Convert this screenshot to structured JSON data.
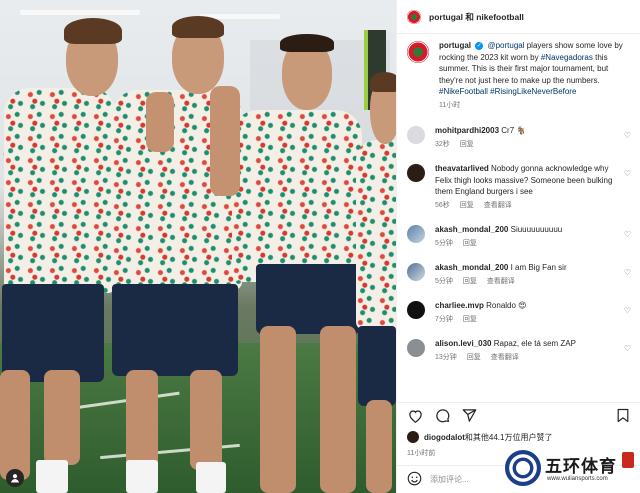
{
  "header": {
    "title": "portugal 和 nikefootball"
  },
  "caption": {
    "username": "portugal",
    "mention": "@portugal",
    "text_1": " players show some love by rocking the 2023 kit worn by ",
    "hashtag_1": "#Navegadoras",
    "text_2": " this summer. This is their first major tournament, but they're not just here to make up the numbers.",
    "hashtag_2": "#NikeFootball",
    "hashtag_3": "#RisingLikeNeverBefore",
    "time": "11小时"
  },
  "comments": [
    {
      "username": "mohitpardhi2003",
      "text": "Cr7 🐐",
      "time": "32秒",
      "reply": "回复",
      "translate": ""
    },
    {
      "username": "theavatarlived",
      "text": "Nobody gonna acknowledge why Felix thigh looks massive? Someone been bulking them England burgers i see",
      "time": "56秒",
      "reply": "回复",
      "translate": "查看翻译"
    },
    {
      "username": "akash_mondal_200",
      "text": "Siuuuuuuuuuu",
      "time": "5分钟",
      "reply": "回复",
      "translate": ""
    },
    {
      "username": "akash_mondal_200",
      "text": "I am Big Fan sir",
      "time": "5分钟",
      "reply": "回复",
      "translate": "查看翻译"
    },
    {
      "username": "charliee.mvp",
      "text": "Ronaldo 😍",
      "time": "7分钟",
      "reply": "回复",
      "translate": ""
    },
    {
      "username": "alison.levi_030",
      "text": "Rapaz, ele tá sem ZAP",
      "time": "13分钟",
      "reply": "回复",
      "translate": "查看翻译"
    }
  ],
  "translate_label": "查看翻译",
  "likes": {
    "username": "diogodalot",
    "text": "和其他44.1万位用户赞了"
  },
  "post_time": "11小时前",
  "comment_box": {
    "placeholder": "添加评论..."
  },
  "watermark": {
    "text": "五环体育",
    "url": "www.wuliansports.com"
  },
  "colors": {
    "link": "#00376b",
    "meta": "#737373",
    "verified": "#0095f6"
  }
}
